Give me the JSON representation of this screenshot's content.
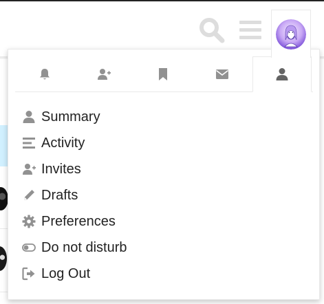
{
  "header": {
    "search_icon": "search-icon",
    "menu_icon": "hamburger-icon",
    "avatar_icon": "user-avatar"
  },
  "colors": {
    "icon_gray": "#919191",
    "icon_light": "#dddddd",
    "active_icon": "#646464",
    "text": "#222222",
    "border": "#e9e9e9"
  },
  "tabs": [
    {
      "icon": "bell-icon"
    },
    {
      "icon": "user-plus-icon"
    },
    {
      "icon": "bookmark-icon"
    },
    {
      "icon": "envelope-icon"
    },
    {
      "icon": "user-icon",
      "active": true
    }
  ],
  "menu": {
    "items": [
      {
        "label": "Summary",
        "icon": "user-icon"
      },
      {
        "label": "Activity",
        "icon": "bars-icon"
      },
      {
        "label": "Invites",
        "icon": "user-plus-icon"
      },
      {
        "label": "Drafts",
        "icon": "pencil-icon"
      },
      {
        "label": "Preferences",
        "icon": "gear-icon"
      },
      {
        "label": "Do not disturb",
        "icon": "toggle-icon"
      },
      {
        "label": "Log Out",
        "icon": "sign-out-icon"
      }
    ]
  }
}
